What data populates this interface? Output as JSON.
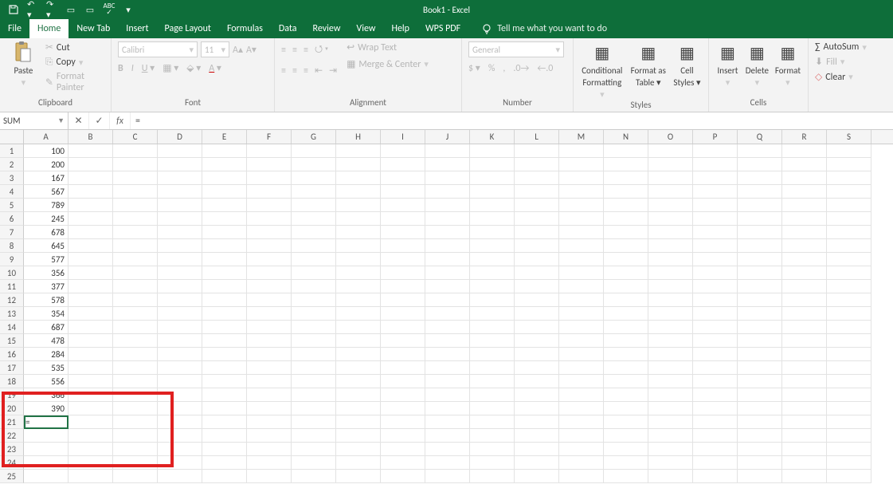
{
  "title": "Book1 - Excel",
  "tabs": [
    "File",
    "Home",
    "New Tab",
    "Insert",
    "Page Layout",
    "Formulas",
    "Data",
    "Review",
    "View",
    "Help",
    "WPS PDF"
  ],
  "tellme": "Tell me what you want to do",
  "clipboard": {
    "cut": "Cut",
    "copy": "Copy",
    "paint": "Format Painter",
    "paste": "Paste",
    "label": "Clipboard"
  },
  "font": {
    "name": "Calibri",
    "size": "11",
    "label": "Font"
  },
  "alignment": {
    "wrap": "Wrap Text",
    "merge": "Merge & Center",
    "label": "Alignment"
  },
  "number": {
    "fmt": "General",
    "label": "Number"
  },
  "styles": {
    "cond": "Conditional",
    "cond2": "Formatting",
    "tbl": "Format as",
    "tbl2": "Table",
    "cell": "Cell",
    "cell2": "Styles",
    "label": "Styles"
  },
  "cells": {
    "insert": "Insert",
    "delete": "Delete",
    "format": "Format",
    "label": "Cells"
  },
  "editing": {
    "sum": "AutoSum",
    "fill": "Fill",
    "clear": "Clear"
  },
  "namebox": "SUM",
  "formula": "=",
  "columns": [
    "A",
    "B",
    "C",
    "D",
    "E",
    "F",
    "G",
    "H",
    "I",
    "J",
    "K",
    "L",
    "M",
    "N",
    "O",
    "P",
    "Q",
    "R",
    "S"
  ],
  "data": {
    "1": "100",
    "2": "200",
    "3": "167",
    "4": "567",
    "5": "789",
    "6": "245",
    "7": "678",
    "8": "645",
    "9": "577",
    "10": "356",
    "11": "377",
    "12": "578",
    "13": "354",
    "14": "687",
    "15": "478",
    "16": "284",
    "17": "535",
    "18": "556",
    "19": "366",
    "20": "390"
  },
  "editCell": "=",
  "rowCount": 25
}
